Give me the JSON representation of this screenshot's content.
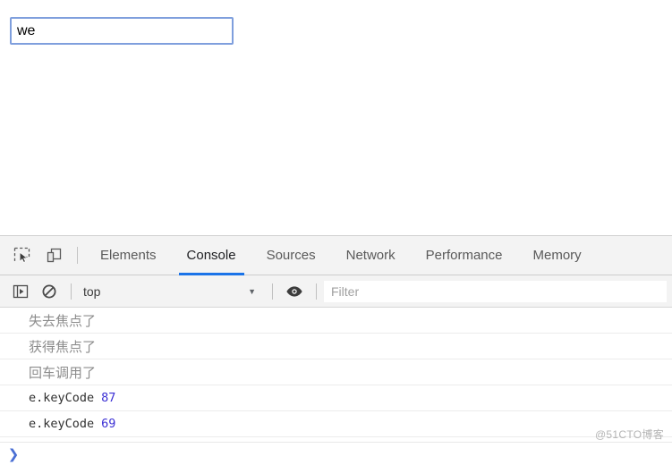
{
  "page": {
    "input": {
      "value": "we",
      "placeholder": ""
    }
  },
  "devtools": {
    "toolbar_icons": [
      {
        "name": "inspect-element-icon",
        "label": "Inspect element"
      },
      {
        "name": "device-toolbar-icon",
        "label": "Toggle device toolbar"
      }
    ],
    "tabs": [
      {
        "label": "Elements",
        "active": false
      },
      {
        "label": "Console",
        "active": true
      },
      {
        "label": "Sources",
        "active": false
      },
      {
        "label": "Network",
        "active": false
      },
      {
        "label": "Performance",
        "active": false
      },
      {
        "label": "Memory",
        "active": false
      }
    ],
    "active_tab": "Console",
    "accent_color": "#1a73e8",
    "console_toolbar": {
      "sidebar_toggle_icon": "console-sidebar-icon",
      "clear_console_icon": "clear-console-icon",
      "context_selector": {
        "value": "top",
        "caret": "▼"
      },
      "eye_icon": "eye-icon",
      "filter": {
        "value": "",
        "placeholder": "Filter"
      }
    },
    "messages": [
      {
        "type": "text",
        "text": "失去焦点了"
      },
      {
        "type": "text",
        "text": "获得焦点了"
      },
      {
        "type": "text",
        "text": "回车调用了"
      },
      {
        "type": "kv",
        "text": "e.keyCode",
        "value": "87"
      },
      {
        "type": "kv",
        "text": "e.keyCode",
        "value": "69"
      }
    ],
    "prompt": {
      "chevron": "❯",
      "value": ""
    }
  },
  "watermark": {
    "text": "@51CTO博客"
  }
}
